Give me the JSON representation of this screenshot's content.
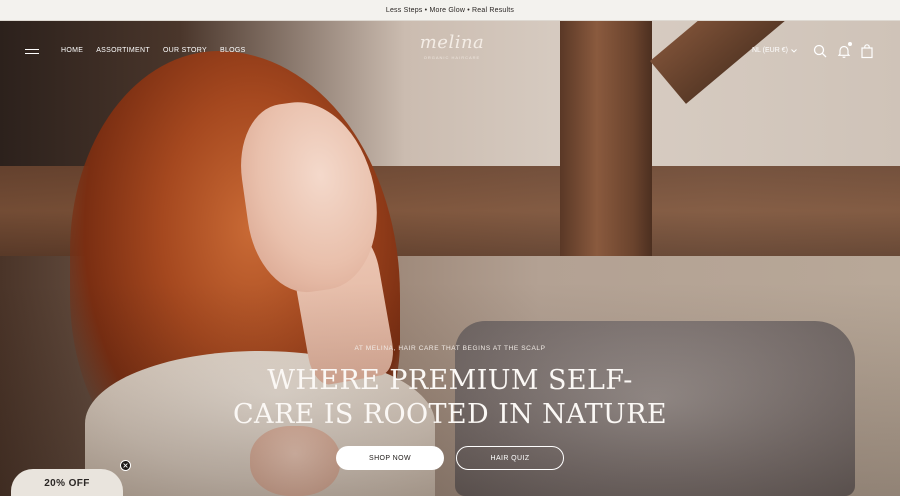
{
  "announcement": {
    "text": "Less Steps • More Glow • Real Results"
  },
  "header": {
    "nav": [
      {
        "label": "HOME"
      },
      {
        "label": "ASSORTIMENT"
      },
      {
        "label": "OUR STORY"
      },
      {
        "label": "BLOGS"
      }
    ],
    "logo": {
      "word": "melina",
      "tagline": "organic haircare"
    },
    "currency": "NL (EUR €)",
    "icons": [
      "menu-icon",
      "search-icon",
      "bell-icon",
      "bag-icon",
      "chevron-down-icon"
    ]
  },
  "hero": {
    "eyebrow": "AT MELINA, HAIR CARE THAT BEGINS AT THE SCALP",
    "headline_line1": "WHERE PREMIUM SELF-",
    "headline_line2": "CARE IS ROOTED IN NATURE",
    "cta_primary": "SHOP NOW",
    "cta_secondary": "HAIR QUIZ"
  },
  "promo": {
    "label": "20% OFF",
    "close_icon": "close-icon"
  },
  "colors": {
    "announcement_bg": "#f3f2ee",
    "text_light": "#ffffff",
    "promo_bg": "#e9e4dd"
  }
}
